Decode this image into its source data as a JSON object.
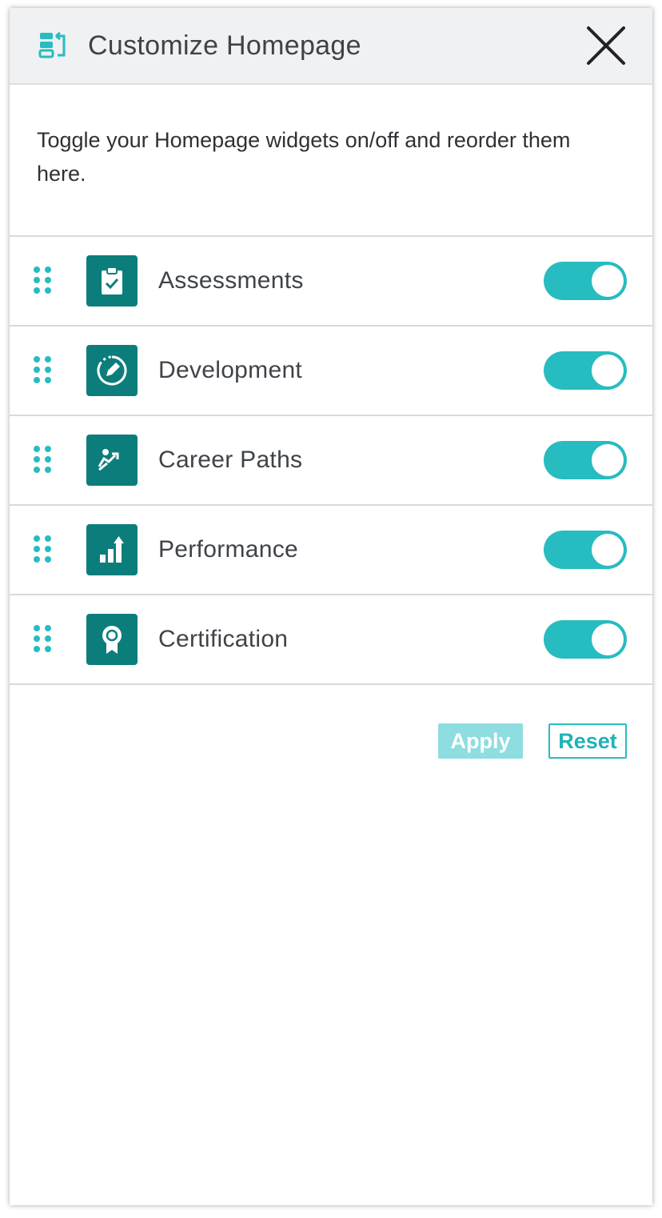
{
  "header": {
    "title": "Customize Homepage",
    "icon": "customize-icon",
    "close_icon": "close-icon"
  },
  "intro": {
    "text": "Toggle your Homepage widgets on/off and reorder them here."
  },
  "widgets": [
    {
      "label": "Assessments",
      "icon": "clipboard-check-icon",
      "enabled": true
    },
    {
      "label": "Development",
      "icon": "pencil-circle-icon",
      "enabled": true
    },
    {
      "label": "Career Paths",
      "icon": "career-climb-icon",
      "enabled": true
    },
    {
      "label": "Performance",
      "icon": "bar-chart-arrow-icon",
      "enabled": true
    },
    {
      "label": "Certification",
      "icon": "award-badge-icon",
      "enabled": true
    }
  ],
  "actions": {
    "apply_label": "Apply",
    "reset_label": "Reset"
  },
  "colors": {
    "accent": "#27bcc0",
    "icon_tile": "#0b7e7c",
    "apply_disabled": "#8edde0",
    "header_bg": "#f0f1f3"
  }
}
